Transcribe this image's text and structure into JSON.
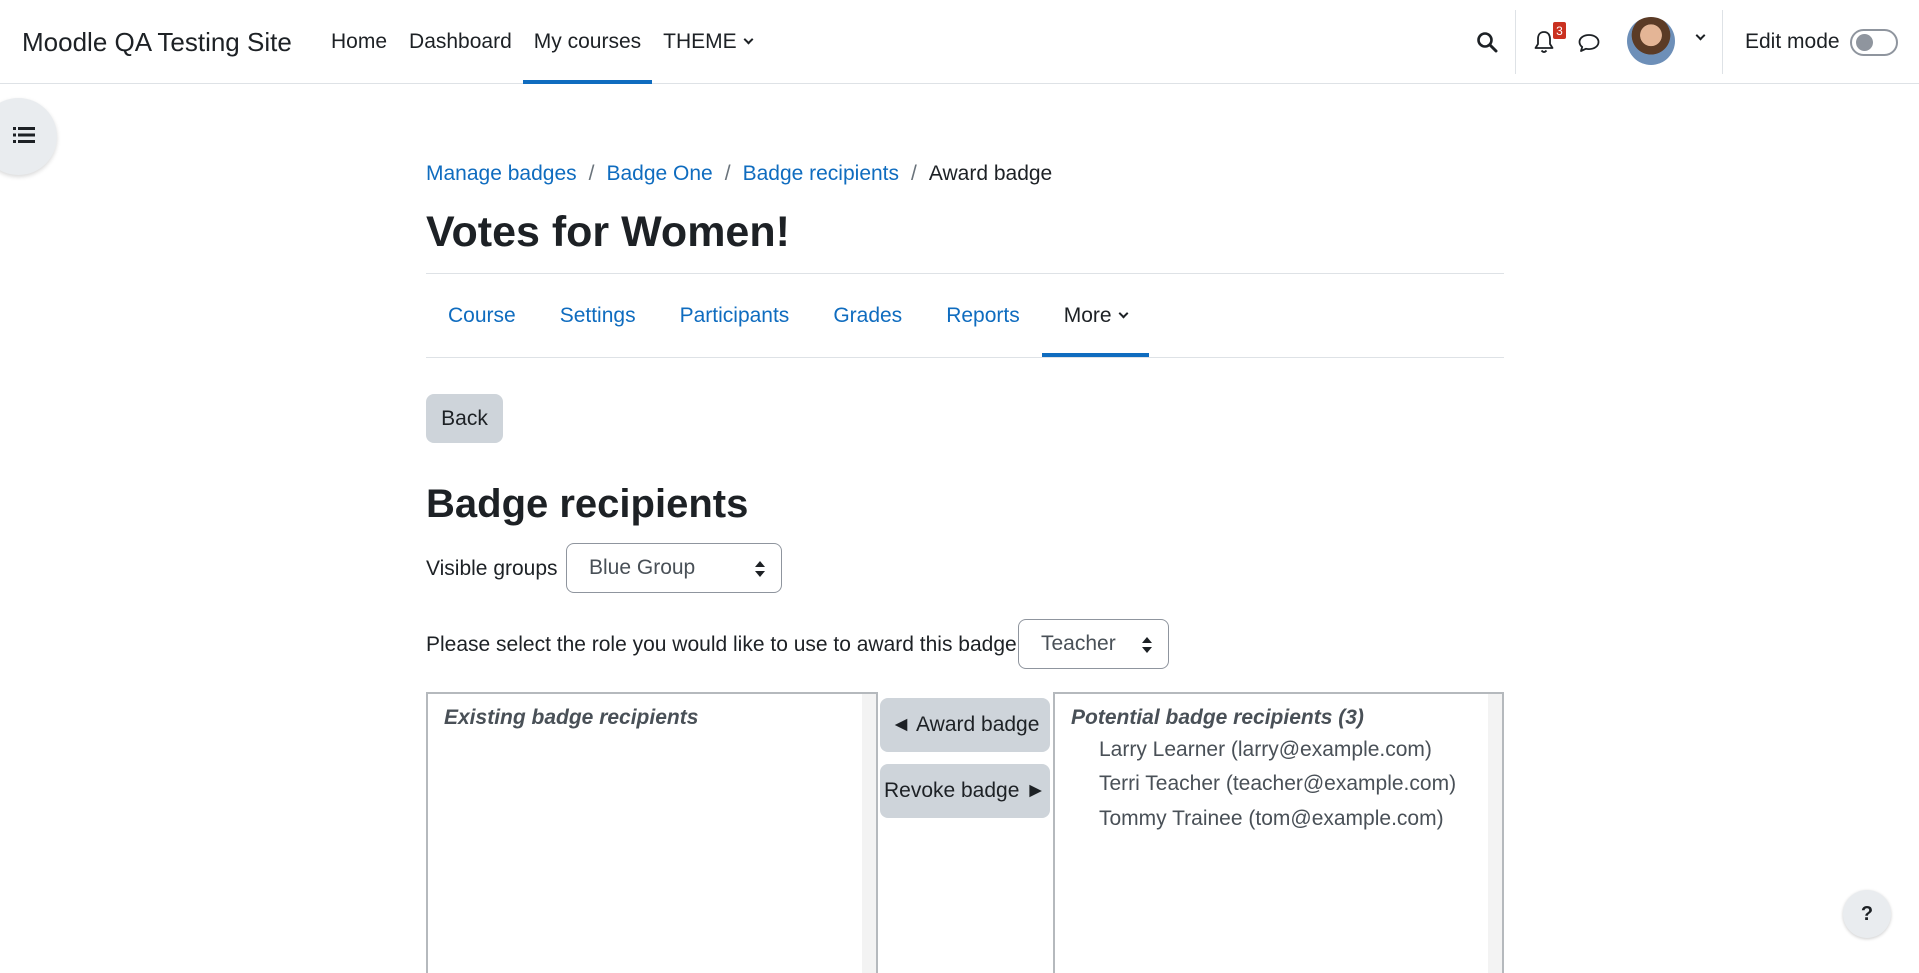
{
  "navbar": {
    "site_name": "Moodle QA Testing Site",
    "items": [
      {
        "label": "Home"
      },
      {
        "label": "Dashboard"
      },
      {
        "label": "My courses"
      },
      {
        "label": "THEME"
      }
    ],
    "active_item": "My courses",
    "notification_count": "3",
    "edit_mode_label": "Edit mode",
    "edit_mode_on": false
  },
  "breadcrumb": {
    "items": [
      {
        "label": "Manage badges"
      },
      {
        "label": "Badge One"
      },
      {
        "label": "Badge recipients"
      }
    ],
    "current": "Award badge"
  },
  "page": {
    "title": "Votes for Women!"
  },
  "secondary_nav": {
    "tabs": [
      {
        "label": "Course"
      },
      {
        "label": "Settings"
      },
      {
        "label": "Participants"
      },
      {
        "label": "Grades"
      },
      {
        "label": "Reports"
      },
      {
        "label": "More"
      }
    ],
    "active_tab": "More"
  },
  "back_button": "Back",
  "section_title": "Badge recipients",
  "groups": {
    "label": "Visible groups",
    "selected": "Blue Group"
  },
  "role": {
    "label": "Please select the role you would like to use to award this badge:",
    "selected": "Teacher"
  },
  "existing": {
    "group_label": "Existing badge recipients",
    "options": []
  },
  "actions": {
    "award": "◄ Award badge",
    "revoke": "Revoke badge ►"
  },
  "potential": {
    "group_label": "Potential badge recipients (3)",
    "options": [
      {
        "label": "Larry Learner (larry@example.com)"
      },
      {
        "label": "Terri Teacher (teacher@example.com)"
      },
      {
        "label": "Tommy Trainee (tom@example.com)"
      }
    ]
  },
  "help_button": "?",
  "colors": {
    "link": "#0f6cbf",
    "text": "#1d2125",
    "button_secondary": "#ced4da",
    "notification_badge": "#ca3120"
  },
  "icons": [
    "search-icon",
    "bell-icon",
    "chat-icon",
    "chevron-down-icon",
    "list-icon"
  ]
}
